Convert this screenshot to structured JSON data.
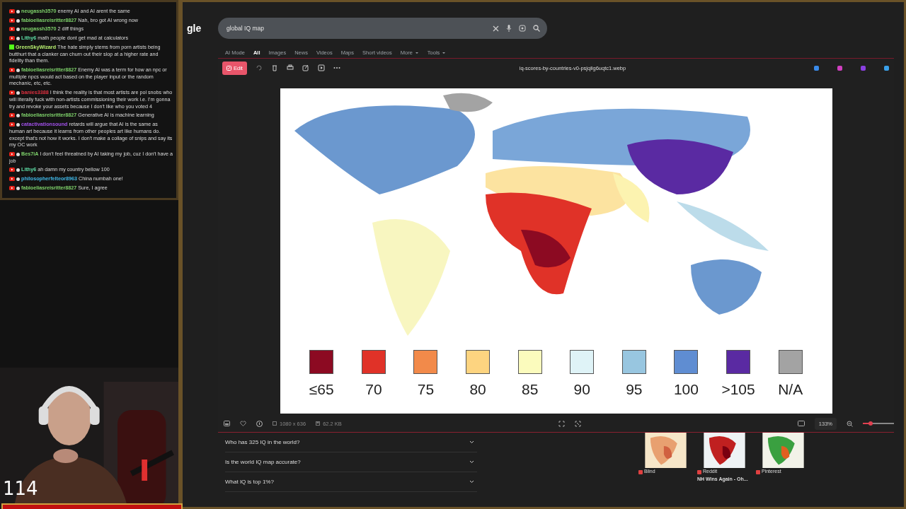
{
  "chat": [
    {
      "kind": "youtube",
      "user": "neugassh3570",
      "color": "#7fd36b",
      "text": "enemy AI and AI arent the same"
    },
    {
      "kind": "youtube",
      "user": "fabioeliasreisritter8827",
      "color": "#7fd36b",
      "text": "Nah, bro got AI wrong now"
    },
    {
      "kind": "youtube",
      "user": "neugassh3570",
      "color": "#7fd36b",
      "text": "2 diff things"
    },
    {
      "kind": "youtube",
      "user": "Lithy6",
      "color": "#5fe0a8",
      "text": "math people dont get mad at calculators"
    },
    {
      "kind": "kick",
      "user": "GreenSkyWizard",
      "color": "#b8f070",
      "text": "The hate simply stems from porn artists being butthurt that a clanker can churn out their slop at a higher rate and fidelity than them."
    },
    {
      "kind": "youtube",
      "user": "fabioeliasreisritter8827",
      "color": "#7fd36b",
      "text": "Enemy AI was a term for how an npc or multiple npcs would act based on the player input or the random mechanic, etc, etc."
    },
    {
      "kind": "youtube",
      "user": "banies3388",
      "color": "#e03040",
      "text": "I think the reality is that most artists are pol snobs who will literally fuck with non-artists commissioning their work i.e. I'm gonna try and revoke your assets because I don't like who you voted 4"
    },
    {
      "kind": "youtube",
      "user": "fabioeliasreisritter8827",
      "color": "#7fd36b",
      "text": "Generative AI is machine learning"
    },
    {
      "kind": "youtube",
      "user": "catactivationsound",
      "color": "#a050e8",
      "text": "retards will argue that AI is the same as human art because it learns from other peoples art like humans do. except that's not how it works. I don't make a collage of snips and say its my OC work"
    },
    {
      "kind": "youtube",
      "user": "Bes7iA",
      "color": "#7fd36b",
      "text": "I don't feel threatned by AI taking my job, cuz I don't have a job"
    },
    {
      "kind": "youtube",
      "user": "Lithy6",
      "color": "#5fe0a8",
      "text": "ah damn my country bellow 100"
    },
    {
      "kind": "youtube",
      "user": "philosopherfelteor8963",
      "color": "#40b8e8",
      "text": "China numbah one!"
    },
    {
      "kind": "youtube",
      "user": "fabioeliasreisritter8827",
      "color": "#7fd36b",
      "text": "Sure, I agree"
    }
  ],
  "counter": "114",
  "logo": "gle",
  "search": {
    "value": "global IQ map"
  },
  "tabs": [
    {
      "label": "AI Mode",
      "selected": false,
      "dropdown": false
    },
    {
      "label": "All",
      "selected": true,
      "dropdown": false
    },
    {
      "label": "Images",
      "selected": false,
      "dropdown": false
    },
    {
      "label": "News",
      "selected": false,
      "dropdown": false
    },
    {
      "label": "Videos",
      "selected": false,
      "dropdown": false
    },
    {
      "label": "Maps",
      "selected": false,
      "dropdown": false
    },
    {
      "label": "Short videos",
      "selected": false,
      "dropdown": false
    },
    {
      "label": "More",
      "selected": false,
      "dropdown": true
    },
    {
      "label": "Tools",
      "selected": false,
      "dropdown": true
    }
  ],
  "viewer": {
    "edit_label": "Edit",
    "filename": "iq-scores-by-countries-v0-psjqlig6uqtc1.webp",
    "legend": [
      {
        "label": "≤65",
        "color": "#8c0a22"
      },
      {
        "label": "70",
        "color": "#e03228"
      },
      {
        "label": "75",
        "color": "#f28a4a"
      },
      {
        "label": "80",
        "color": "#fdd480"
      },
      {
        "label": "85",
        "color": "#fbfbbd"
      },
      {
        "label": "90",
        "color": "#dff3f7"
      },
      {
        "label": "95",
        "color": "#98c6e0"
      },
      {
        "label": "100",
        "color": "#5f8dd2"
      },
      {
        "label": ">105",
        "color": "#5a2aa2"
      },
      {
        "label": "N/A",
        "color": "#a3a3a3"
      }
    ],
    "dimensions": "1080 x 636",
    "size": "62.2 KB",
    "zoom": "133%",
    "zoom_slider": {
      "level": 0.25
    }
  },
  "questions": [
    "Who has 325 IQ in the world?",
    "Is the world IQ map accurate?",
    "What IQ is top 1%?"
  ],
  "thumbnails": [
    {
      "source": "Blind"
    },
    {
      "source": "Reddit",
      "title": "NH Wins Again - Oh..."
    },
    {
      "source": "Pinterest"
    }
  ]
}
